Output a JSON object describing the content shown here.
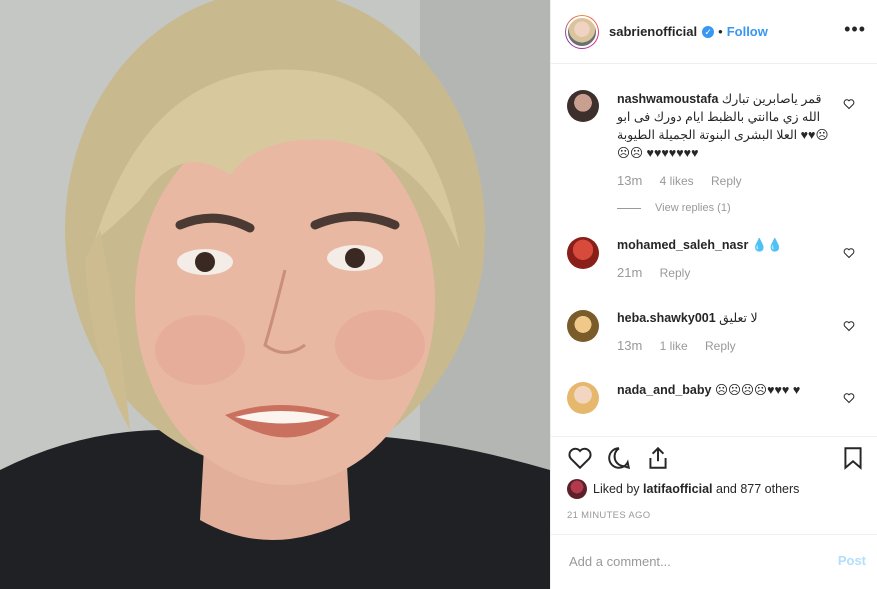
{
  "post": {
    "username": "sabrienofficial",
    "verified_symbol": "✓",
    "separator": "•",
    "follow_label": "Follow",
    "more_label": "•••"
  },
  "comments": [
    {
      "user": "nashwamoustafa",
      "text": "قمر ياصابرين تبارك الله زي ماانتي بالظبط ايام دورك فى ابو العلا البشرى البنوتة الجميلة الطيوبة ♥♥☹☹☹ ♥♥♥♥♥♥♥",
      "time": "13m",
      "likes": "4 likes",
      "reply": "Reply",
      "view_replies": "View replies (1)"
    },
    {
      "user": "mohamed_saleh_nasr",
      "text": "💧💧",
      "time": "21m",
      "reply": "Reply"
    },
    {
      "user": "heba.shawky001",
      "text": "لا تعليق",
      "time": "13m",
      "likes": "1 like",
      "reply": "Reply"
    },
    {
      "user": "nada_and_baby",
      "text": "☹☹☹☹♥♥♥ ♥"
    }
  ],
  "likes": {
    "prefix": "Liked by",
    "user": "latifaofficial",
    "suffix": "and 877 others"
  },
  "timeago": "21 MINUTES AGO",
  "add_comment": {
    "placeholder": "Add a comment...",
    "post_label": "Post"
  },
  "icons": {
    "like": "heart-icon",
    "comment": "comment-icon",
    "share": "share-icon",
    "save": "bookmark-icon"
  },
  "colors": {
    "accent": "#3897f0",
    "post_disabled": "#b2dffc",
    "muted": "#999999",
    "text": "#262626"
  }
}
